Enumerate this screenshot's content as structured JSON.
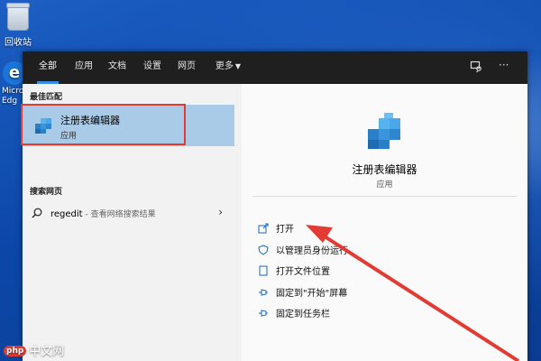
{
  "desktop": {
    "recycle_bin_label": "回收站",
    "edge_label": "Micro\nEdg"
  },
  "search_panel": {
    "tabs": [
      {
        "label": "全部",
        "active": true
      },
      {
        "label": "应用"
      },
      {
        "label": "文档"
      },
      {
        "label": "设置"
      },
      {
        "label": "网页"
      },
      {
        "label": "更多"
      }
    ],
    "top_icons": [
      "feedback-icon",
      "more-icon"
    ],
    "more_icon_text": "···",
    "best_match": {
      "section_title": "最佳匹配",
      "name": "注册表编辑器",
      "type": "应用"
    },
    "web_search": {
      "section_title": "搜索网页",
      "query": "regedit",
      "hint": " - 查看网络搜索结果"
    },
    "detail": {
      "app_name": "注册表编辑器",
      "app_type": "应用",
      "actions": [
        {
          "label": "打开",
          "icon": "open-icon"
        },
        {
          "label": "以管理员身份运行",
          "icon": "admin-shield-icon"
        },
        {
          "label": "打开文件位置",
          "icon": "file-location-icon"
        },
        {
          "label": "固定到\"开始\"屏幕",
          "icon": "pin-icon"
        },
        {
          "label": "固定到任务栏",
          "icon": "pin-icon"
        }
      ]
    }
  },
  "watermark": {
    "badge": "php",
    "text": "中文网"
  },
  "colors": {
    "accent": "#3b8ce4",
    "highlight": "#a9cbe8",
    "annotation_red": "#e23b34"
  }
}
